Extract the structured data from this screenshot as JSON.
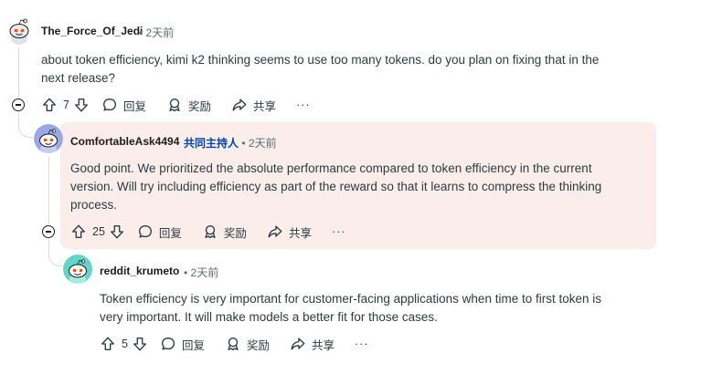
{
  "comments": [
    {
      "username": "The_Force_Of_Jedi",
      "sep": "•",
      "time": "2天前",
      "body_line1": "about token efficiency, kimi k2 thinking seems to use too many tokens. do you plan on fixing that in the",
      "body_line2": "next release?",
      "votes": "7",
      "reply": "回复",
      "award": "奖励",
      "share": "共享",
      "more": "···"
    },
    {
      "username": "ComfortableAsk4494",
      "mod_badge": "共同主持人",
      "sep": "•",
      "time": "2天前",
      "body_line1": "Good point. We prioritized the absolute performance compared to token efficiency in the current",
      "body_line2": "version. Will try including efficiency as part of the reward so that it learns to compress the thinking",
      "body_line3": "process.",
      "votes": "25",
      "reply": "回复",
      "award": "奖励",
      "share": "共享",
      "more": "···"
    },
    {
      "username": "reddit_krumeto",
      "sep": "•",
      "time": "2天前",
      "body_line1": "Token efficiency is very important for customer-facing applications when time to first token is",
      "body_line2": "very important. It will make models a better fit for those cases.",
      "votes": "5",
      "reply": "回复",
      "award": "奖励",
      "share": "共享",
      "more": "···"
    }
  ],
  "colors": {
    "highlight_bg": "#fbeeea",
    "mod_badge": "#0045ac",
    "meta": "#576f76",
    "thread_line": "#d6dce0"
  },
  "icons": [
    "snoo-avatar-icon",
    "upvote-icon",
    "downvote-icon",
    "comment-icon",
    "award-icon",
    "share-icon",
    "collapse-icon"
  ]
}
